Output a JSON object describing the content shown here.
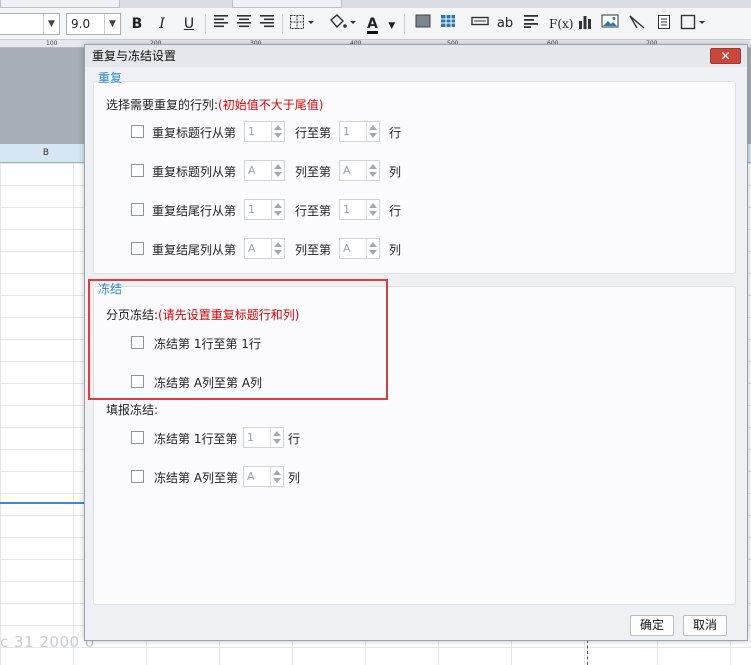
{
  "toolbar": {
    "font_size": "9.0",
    "bold": "B",
    "italic": "I",
    "underline": "U",
    "font_color_letter": "A",
    "text_ab": "ab",
    "formula": "F(x)"
  },
  "ruler": {
    "ticks": [
      "100",
      "200",
      "300",
      "400",
      "500",
      "600",
      "700"
    ]
  },
  "sheet": {
    "column_b": "B",
    "date_text": "c 31 2000 0"
  },
  "dialog": {
    "title": "重复与冻结设置",
    "close": "✕",
    "repeat": {
      "title": "重复",
      "instruction": "选择需要重复的行列:",
      "hint": "(初始值不大于尾值)",
      "rows": [
        {
          "label": "重复标题行从第",
          "from": "1",
          "mid": "行至第",
          "to": "1",
          "unit": "行"
        },
        {
          "label": "重复标题列从第",
          "from": "A",
          "mid": "列至第",
          "to": "A",
          "unit": "列"
        },
        {
          "label": "重复结尾行从第",
          "from": "1",
          "mid": "行至第",
          "to": "1",
          "unit": "行"
        },
        {
          "label": "重复结尾列从第",
          "from": "A",
          "mid": "列至第",
          "to": "A",
          "unit": "列"
        }
      ]
    },
    "freeze": {
      "title": "冻结",
      "paging_label": "分页冻结:",
      "paging_hint": "(请先设置重复标题行和列)",
      "paging_rows": [
        "冻结第 1行至第 1行",
        "冻结第 A列至第 A列"
      ],
      "fill_label": "填报冻结:",
      "fill_rows": [
        {
          "prefix": "冻结第 1行至第",
          "value": "1",
          "unit": "行"
        },
        {
          "prefix": "冻结第 A列至第",
          "value": "A",
          "unit": "列"
        }
      ]
    },
    "buttons": {
      "ok": "确定",
      "cancel": "取消"
    }
  }
}
